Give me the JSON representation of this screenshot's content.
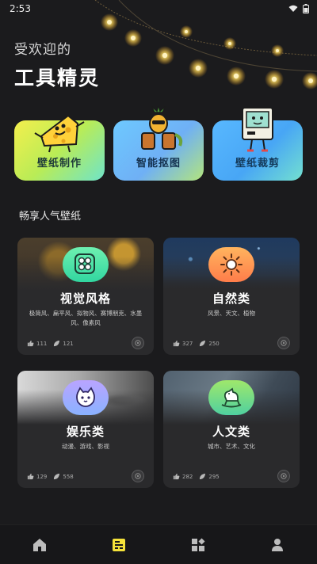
{
  "status_bar": {
    "time": "2:53"
  },
  "hero": {
    "subtitle": "受欢迎的",
    "title": "工具精灵"
  },
  "tools": [
    {
      "label": "壁纸制作",
      "icon": "cheese-character-icon"
    },
    {
      "label": "智能抠图",
      "icon": "pineapple-drums-icon"
    },
    {
      "label": "壁纸裁剪",
      "icon": "retro-computer-icon"
    }
  ],
  "section": {
    "title": "畅享人气壁纸"
  },
  "cards": [
    {
      "title": "视觉风格",
      "desc": "极简风、扁平风、拟物风、赛博朋克、水墨风、像素风",
      "likes": "111",
      "collects": "121",
      "icon": "grid-flower-icon"
    },
    {
      "title": "自然类",
      "desc": "风景、天文、植物",
      "likes": "327",
      "collects": "250",
      "icon": "sun-icon"
    },
    {
      "title": "娱乐类",
      "desc": "动漫、游戏、影视",
      "likes": "129",
      "collects": "558",
      "icon": "cat-face-icon"
    },
    {
      "title": "人文类",
      "desc": "城市、艺术、文化",
      "likes": "282",
      "collects": "295",
      "icon": "rocking-horse-icon"
    }
  ],
  "bottom_nav": [
    {
      "name": "home",
      "icon": "home-icon",
      "active": false
    },
    {
      "name": "wallpaper",
      "icon": "document-list-icon",
      "active": true
    },
    {
      "name": "apps",
      "icon": "apps-grid-icon",
      "active": false
    },
    {
      "name": "profile",
      "icon": "person-icon",
      "active": false
    }
  ],
  "colors": {
    "background": "#1b1b1d",
    "card": "#2a2a2c",
    "active_nav": "#f5e23a",
    "inactive_nav": "#bdbdbd"
  }
}
